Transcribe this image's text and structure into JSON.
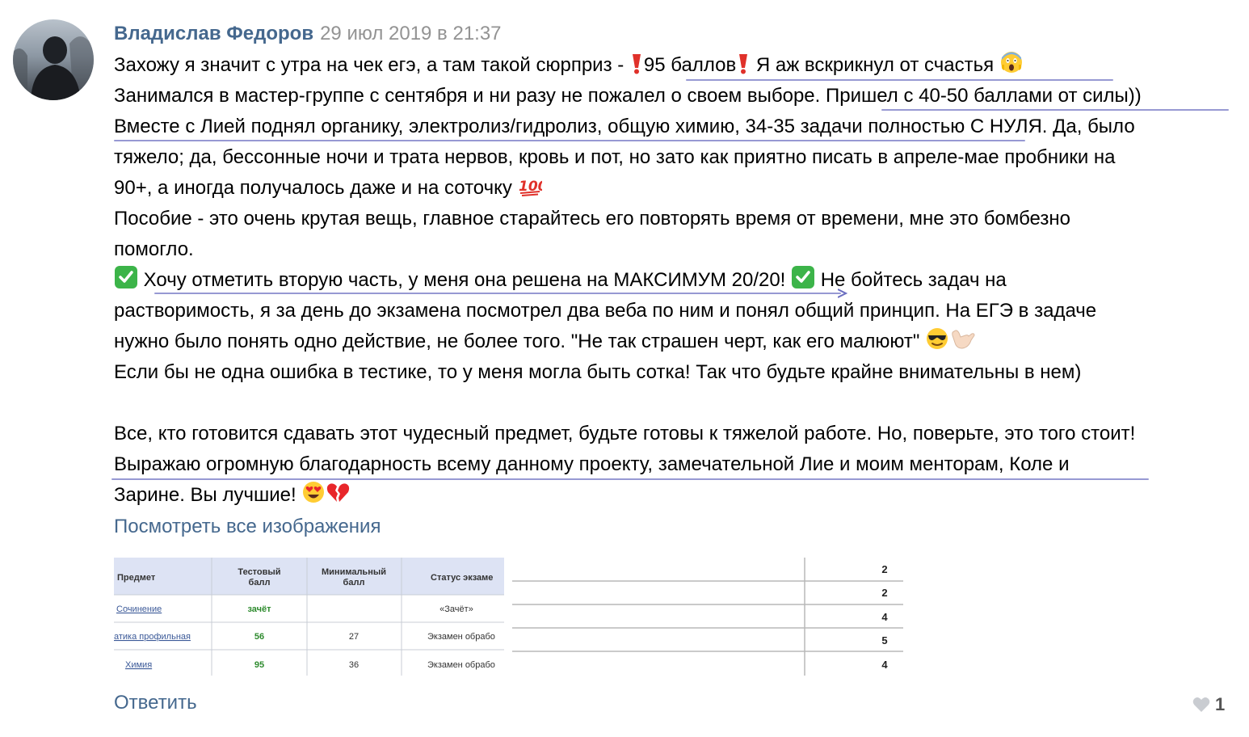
{
  "post": {
    "author": "Владислав Федоров",
    "date": "29 июл 2019 в 21:37",
    "lines": [
      {
        "a": "Захожу я значит с утра на чек егэ, а там такой сюрприз - ",
        "b": "95 баллов",
        "c": " Я аж вскрикнул от счастья "
      },
      {
        "a": "Занимался в мастер-группе с сентября и ни разу не пожалел о своем выборе. Пришел с 40-50 баллами от силы))"
      },
      {
        "a": "Вместе с Лией поднял органику, электролиз/гидролиз, общую химию, 34-35 задачи полностью С НУЛЯ. Да, было"
      },
      {
        "a": "тяжело; да, бессонные ночи и трата нервов, кровь и пот, но зато как приятно писать в апреле-мае пробники на"
      },
      {
        "a": "90+, а иногда получалось даже и на соточку "
      },
      {
        "a": "Пособие - это очень крутая вещь, главное старайтесь его повторять время от времени, мне это бомбезно"
      },
      {
        "a": "помогло."
      },
      {
        "a": " Хочу отметить вторую часть, у меня она решена на МАКСИМУМ 20/20! ",
        "b": " Не бойтесь задач на"
      },
      {
        "a": "растворимость, я за день до экзамена посмотрел два веба по ним и понял общий принцип. На ЕГЭ в задаче"
      },
      {
        "a": "нужно было понять одно действие, не более того. \"Не так страшен черт, как его малюют\" "
      },
      {
        "a": "Если бы не одна ошибка в тестике, то у меня могла быть сотка! Так что будьте крайне внимательны в нем)"
      },
      {
        "a": "Все, кто готовится сдавать этот чудесный предмет, будьте готовы к тяжелой работе. Но, поверьте, это того стоит!"
      },
      {
        "a": "Выражаю огромную благодарность всему данному проекту, замечательной Лие и моим менторам, Коле и"
      },
      {
        "a": "Зарине. Вы лучшие! "
      }
    ],
    "view_all": "Посмотреть все изображения",
    "reply": "Ответить",
    "likes": "1"
  },
  "results_table": {
    "headers": [
      "Предмет",
      "Тестовый балл",
      "Минимальный балл",
      "Статус экзаме"
    ],
    "rows": [
      [
        "Сочинение",
        "зачёт",
        "",
        "«Зачёт»"
      ],
      [
        "атика профильная",
        "56",
        "27",
        "Экзамен обрабо"
      ],
      [
        "Химия",
        "95",
        "36",
        "Экзамен обрабо"
      ]
    ]
  },
  "grades_table": {
    "values": [
      "2",
      "2",
      "4",
      "5",
      "4"
    ]
  },
  "icons": [
    "exclamation-icon",
    "scream-emoji-icon",
    "hundred-points-icon",
    "check-mark-icon",
    "sunglasses-emoji-icon",
    "call-me-hand-icon",
    "heart-eyes-emoji-icon",
    "broken-heart-icon",
    "heart-icon"
  ],
  "colors": {
    "link": "#45688e",
    "date": "#939393",
    "underline": "#6b6ec0",
    "check": "#3cb449",
    "exclamation": "#e0312a",
    "table_header": "#dde3f4",
    "score_green": "#2e8b2e"
  }
}
